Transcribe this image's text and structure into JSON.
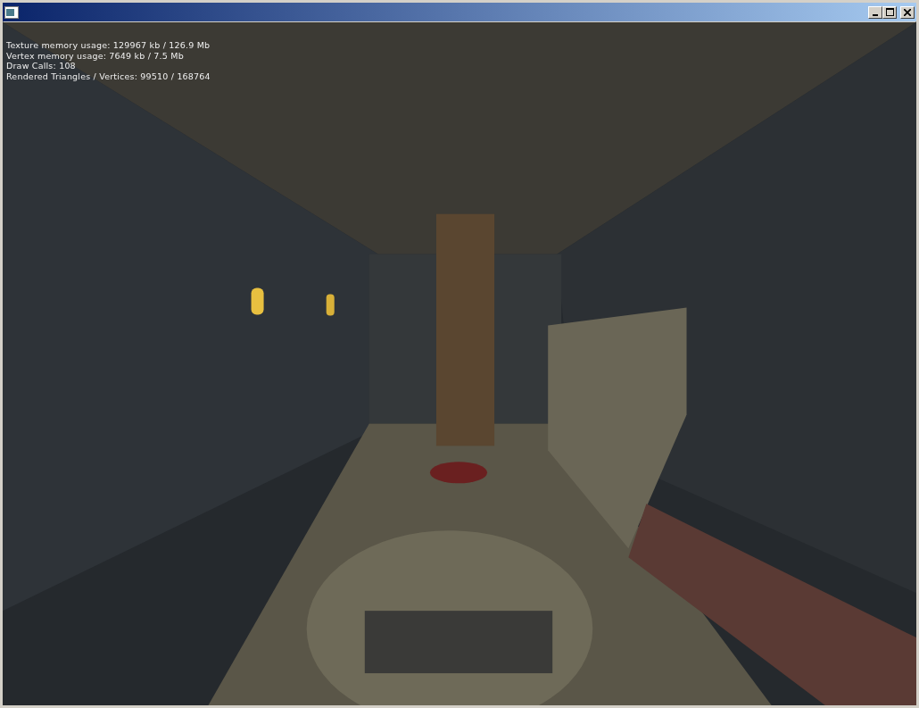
{
  "stats": [
    "Texture memory usage: 129967 kb / 126.9 Mb",
    "Vertex memory usage: 7649 kb / 7.5 Mb",
    "Draw Calls: 108",
    "Rendered Triangles / Vertices: 99510 / 168764"
  ]
}
